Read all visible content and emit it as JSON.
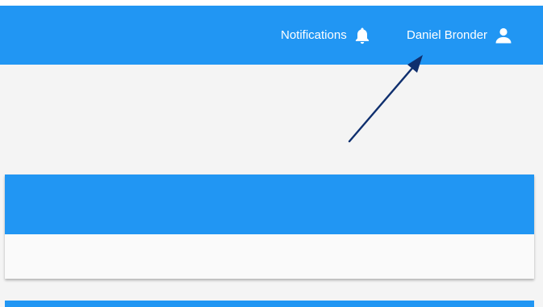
{
  "top_bar": {
    "notifications_label": "Notifications",
    "notifications_icon": "bell-icon",
    "user_name": "Daniel Bronder",
    "user_icon": "user-icon"
  },
  "colors": {
    "primary": "#2196f3",
    "page_background": "#f4f4f4",
    "card_body": "#fafafa",
    "annotation_arrow": "#0f2f6e"
  }
}
